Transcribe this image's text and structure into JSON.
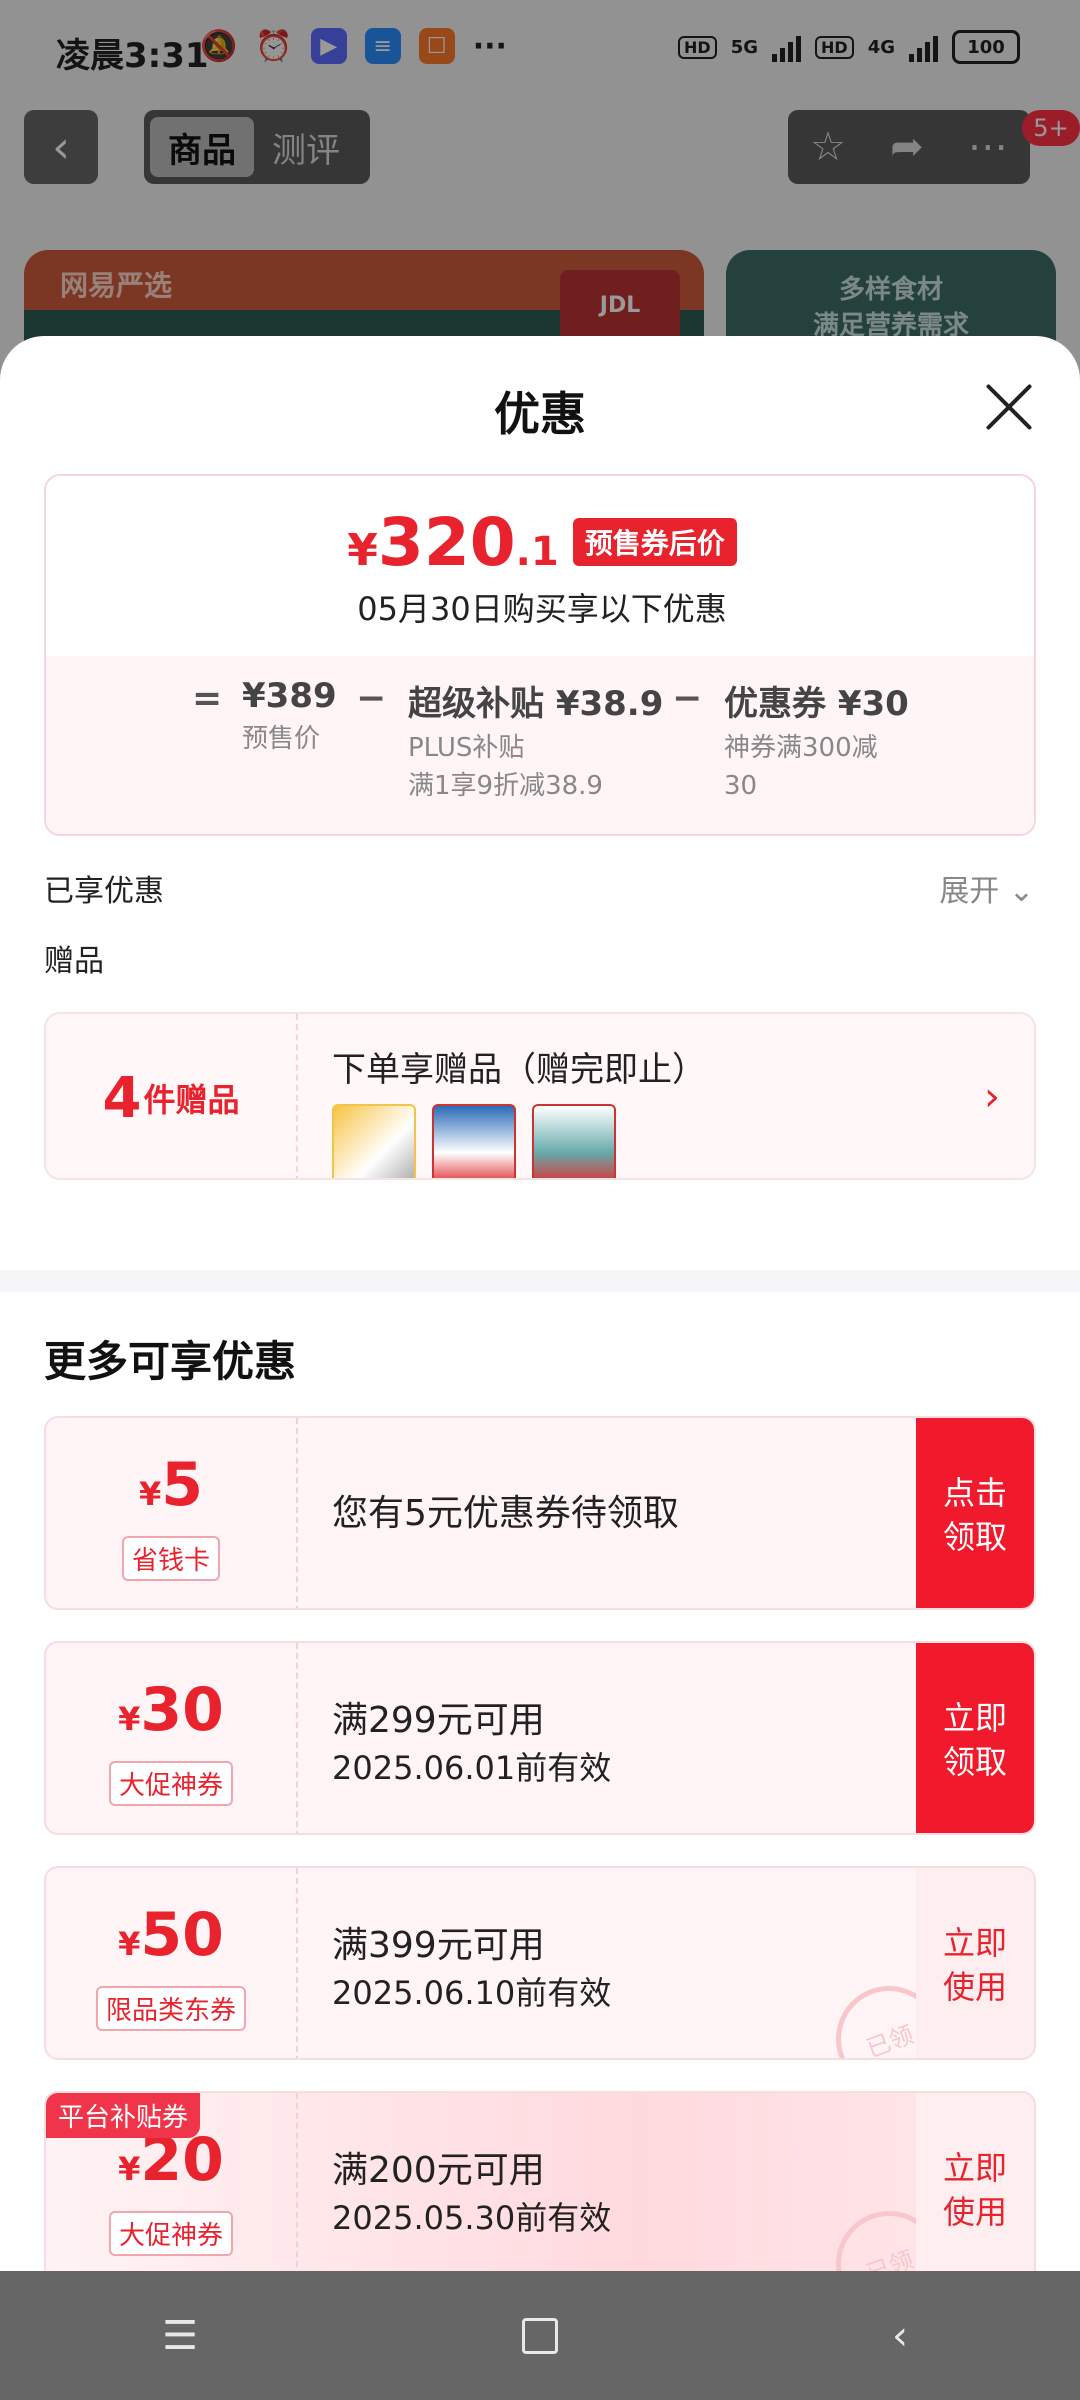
{
  "status_bar": {
    "time": "凌晨3:31",
    "more": "···",
    "hd1": "HD",
    "net1": "5G",
    "hd2": "HD",
    "net2": "4G",
    "battery": "100"
  },
  "top_nav": {
    "tabs": [
      "商品",
      "测评"
    ],
    "active_tab": "商品",
    "badge": "5+"
  },
  "banner": {
    "logo_text": "网易严选",
    "jdl_text": "JDL",
    "right_text_1": "多样食材",
    "right_text_2": "满足营养需求"
  },
  "sheet": {
    "title": "优惠"
  },
  "price_card": {
    "currency": "¥",
    "price_int": "320",
    "price_dec": ".1",
    "tag": "预售券后价",
    "subtitle": "05月30日购买享以下优惠",
    "eq": "=",
    "minus": "−",
    "base": {
      "title": "¥389",
      "sub": "预售价"
    },
    "subsidy": {
      "title": "超级补贴 ¥38.9",
      "sub1": "PLUS补贴",
      "sub2": "满1享9折减38.9"
    },
    "coupon": {
      "title": "优惠券 ¥30",
      "sub1": "神券满300减",
      "sub2": "30"
    }
  },
  "enjoyed": {
    "label": "已享优惠",
    "expand": "展开"
  },
  "gift": {
    "label": "赠品",
    "count": "4",
    "count_text": "件赠品",
    "title": "下单享赠品（赠完即止）",
    "arrow": "›"
  },
  "more": {
    "title": "更多可享优惠",
    "coupons": [
      {
        "yen": "¥",
        "amount": "5",
        "tag": "省钱卡",
        "line1": "您有5元优惠券待领取",
        "line2": "",
        "button": [
          "点击",
          "领取"
        ],
        "style": "solid"
      },
      {
        "yen": "¥",
        "amount": "30",
        "tag": "大促神券",
        "line1": "满299元可用",
        "line2": "2025.06.01前有效",
        "button": [
          "立即",
          "领取"
        ],
        "style": "solid"
      },
      {
        "yen": "¥",
        "amount": "50",
        "tag": "限品类东券",
        "line1": "满399元可用",
        "line2": "2025.06.10前有效",
        "button": [
          "立即",
          "使用"
        ],
        "style": "light",
        "stamp": "已领"
      },
      {
        "yen": "¥",
        "amount": "20",
        "tag": "大促神券",
        "line1": "满200元可用",
        "line2": "2025.05.30前有效",
        "button": [
          "立即",
          "使用"
        ],
        "style": "light",
        "stamp": "已领",
        "corner": "平台补贴券"
      }
    ]
  },
  "colors": {
    "accent": "#e8232e",
    "accent_bright": "#f01a2c"
  },
  "icons": [
    "back-icon",
    "star-icon",
    "share-icon",
    "more-icon",
    "close-icon",
    "chevron-down-icon",
    "chevron-right-icon",
    "menu-icon",
    "home-icon",
    "nav-back-icon"
  ]
}
